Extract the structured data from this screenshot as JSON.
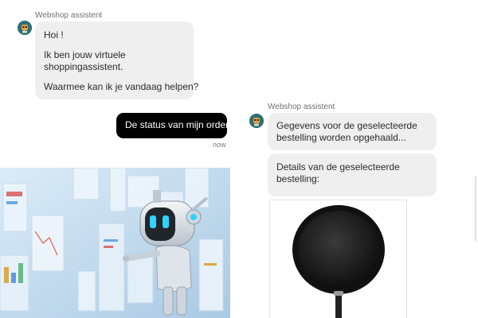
{
  "chat_left": {
    "sender": "Webshop assistent",
    "greeting": {
      "line1": "Hoi !",
      "line2": "Ik ben jouw virtuele",
      "line3": "shoppingassistent.",
      "line4": "Waarmee kan ik je vandaag helpen?"
    },
    "user_message": {
      "text": "De status van mijn order",
      "time": "now"
    }
  },
  "chat_right": {
    "sender": "Webshop assistent",
    "message1": {
      "line1": "Gegevens voor de geselecteerde",
      "line2": "bestelling worden opgehaald..."
    },
    "message2": {
      "line1": "Details van de geselecteerde",
      "line2": "bestelling:"
    }
  },
  "icons": {
    "avatar": "robot-avatar-icon",
    "hero": "robot-illustration",
    "product": "frying-pan-image"
  },
  "colors": {
    "bot_bubble": "#efefef",
    "user_bubble": "#000000",
    "avatar_bg": "#2f6f73"
  }
}
